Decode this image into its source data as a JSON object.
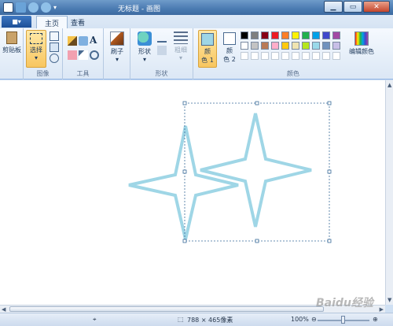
{
  "window": {
    "title": "无标题 - 画图",
    "minimize_icon": "minimize-icon",
    "maximize_icon": "maximize-icon",
    "close_icon": "close-icon"
  },
  "menu": {
    "app_button_label": "■▾"
  },
  "tabs": [
    {
      "label": "主页",
      "active": true
    },
    {
      "label": "查看",
      "active": false
    }
  ],
  "ribbon": {
    "clipboard": {
      "label": "剪贴板",
      "group_label": ""
    },
    "image": {
      "select_label": "选择",
      "group_label": "图像"
    },
    "tools": {
      "group_label": "工具"
    },
    "brushes": {
      "label": "刷子"
    },
    "shapes": {
      "label": "形状",
      "group_label": "形状"
    },
    "outline": {
      "label": "粗细"
    },
    "colors": {
      "color1_label_top": "颜",
      "color1_label_bottom": "色 1",
      "color2_label_top": "颜",
      "color2_label_bottom": "色 2",
      "edit_label": "编辑颜色",
      "group_label": "颜色",
      "color1_value": "#9fd6e6",
      "color2_value": "#ffffff",
      "palette_row1": [
        "#000000",
        "#7f7f7f",
        "#880015",
        "#ed1c24",
        "#ff7f27",
        "#fff200",
        "#22b14c",
        "#00a2e8",
        "#3f48cc",
        "#a349a4"
      ],
      "palette_row2": [
        "#ffffff",
        "#c3c3c3",
        "#b97a57",
        "#ffaec9",
        "#ffc90e",
        "#efe4b0",
        "#b5e61d",
        "#99d9ea",
        "#7092be",
        "#c8bfe7"
      ],
      "palette_row3": [
        "#ffffff",
        "#ffffff",
        "#ffffff",
        "#ffffff",
        "#ffffff",
        "#ffffff",
        "#ffffff",
        "#ffffff",
        "#ffffff",
        "#ffffff"
      ]
    }
  },
  "canvas": {
    "stroke_color": "#9fd6e6"
  },
  "status": {
    "image_size": "788 × 465像素",
    "zoom": "100%"
  },
  "watermark": "Baidu经验"
}
